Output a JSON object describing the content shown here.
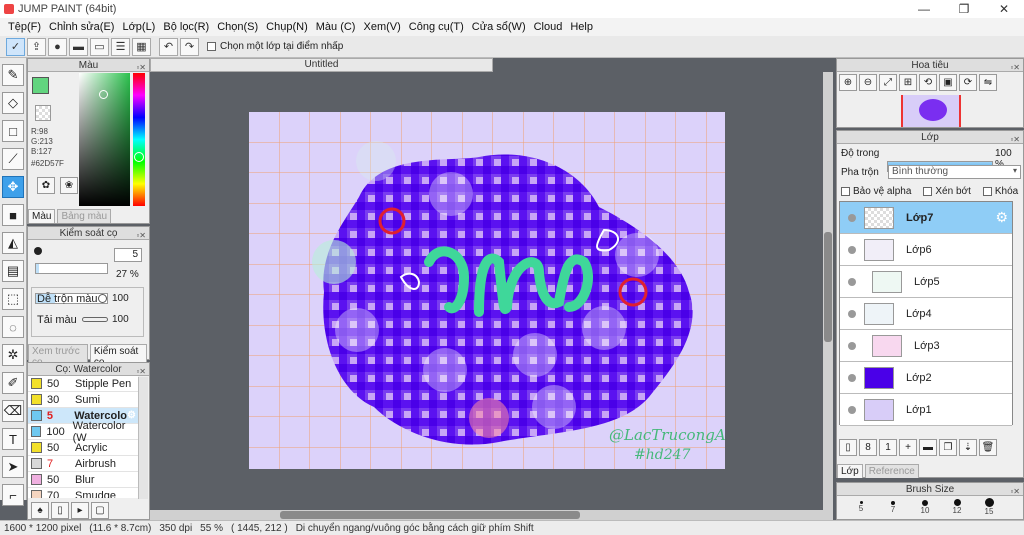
{
  "app": {
    "title": "JUMP PAINT (64bit)",
    "minimize": "—",
    "maximize": "❐",
    "close": "✕"
  },
  "menu": [
    "Tệp(F)",
    "Chỉnh sửa(E)",
    "Lớp(L)",
    "Bộ lọc(R)",
    "Chọn(S)",
    "Chụp(N)",
    "Màu (C)",
    "Xem(V)",
    "Công cụ(T)",
    "Cửa sổ(W)",
    "Cloud",
    "Help"
  ],
  "toolbar": {
    "option_label": "Chọn một lớp tại điểm nhấp",
    "undo_icon": "undo-icon",
    "redo_icon": "redo-icon"
  },
  "color_panel": {
    "title": "Màu",
    "r": "R:98",
    "g": "G:213",
    "b": "B:127",
    "hex": "#62D57F",
    "main_color": "#62d57f",
    "sub_color": "#f0a020",
    "tab_color": "Màu",
    "tab_palette": "Bảng màu"
  },
  "brush_control": {
    "title": "Kiểm soát cọ",
    "size_value": "5",
    "opacity_value": "27 %",
    "mix_label": "Dễ trộn màu",
    "mix_value": "100",
    "load_label": "Tải màu",
    "load_value": "100",
    "tab_preview": "Xem trước cọ",
    "tab_control": "Kiểm soát cọ"
  },
  "brush_list": {
    "title": "Cọ: Watercolor",
    "items": [
      {
        "size": "50",
        "name": "Stipple Pen",
        "color": "#f2e02a"
      },
      {
        "size": "30",
        "name": "Sumi",
        "color": "#f2e02a"
      },
      {
        "size": "5",
        "name": "Watercolo",
        "color": "#6ec8f0",
        "selected": true
      },
      {
        "size": "100",
        "name": "Watercolor (W",
        "color": "#6ec8f0"
      },
      {
        "size": "50",
        "name": "Acrylic",
        "color": "#f2e02a"
      },
      {
        "size": "7",
        "name": "Airbrush",
        "color": "#d8d8d8"
      },
      {
        "size": "50",
        "name": "Blur",
        "color": "#f0b0e0"
      },
      {
        "size": "70",
        "name": "Smudge",
        "color": "#f5d5c0"
      }
    ]
  },
  "document": {
    "tab": "Untitled",
    "signature_line1": "@LacTrucongAn",
    "signature_line2": "#hd247",
    "lettering": "Um"
  },
  "navigator": {
    "title": "Hoa tiêu"
  },
  "layers": {
    "title": "Lớp",
    "opacity_label": "Độ trong",
    "opacity_value": "100 %",
    "opacity_fraction": 1.0,
    "blend_label": "Pha trộn",
    "blend_value": "Bình thường",
    "protect_alpha": "Bảo vệ alpha",
    "clip": "Xén bớt",
    "lock": "Khóa",
    "items": [
      {
        "name": "Lớp7",
        "selected": true
      },
      {
        "name": "Lớp6"
      },
      {
        "name": "Lớp5"
      },
      {
        "name": "Lớp4"
      },
      {
        "name": "Lớp3"
      },
      {
        "name": "Lớp2"
      },
      {
        "name": "Lớp1"
      }
    ],
    "tab_layer": "Lớp",
    "tab_reference": "Reference"
  },
  "brush_size": {
    "title": "Brush Size",
    "sizes": [
      "5",
      "7",
      "10",
      "12",
      "15"
    ]
  },
  "status": {
    "size": "1600 * 1200 pixel",
    "physical": "(11.6 * 8.7cm)",
    "dpi": "350 dpi",
    "zoom": "55 %",
    "coords": "( 1445, 212 )",
    "hint": "Di chuyển ngang/vuông góc bằng cách giữ phím Shift"
  }
}
